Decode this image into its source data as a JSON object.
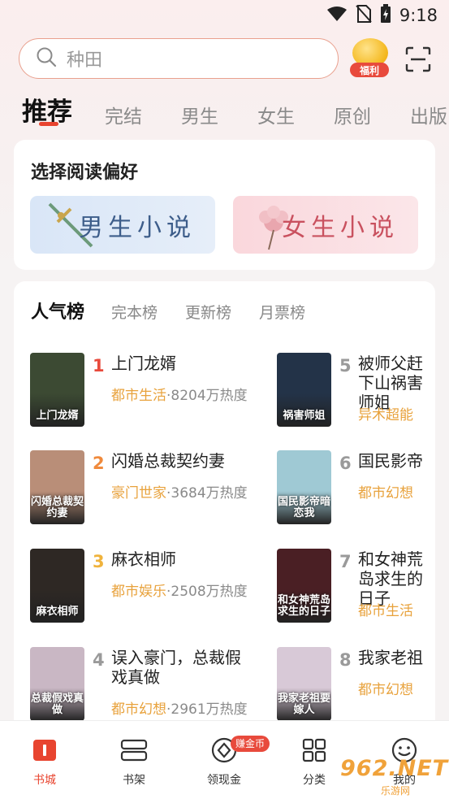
{
  "status_bar": {
    "time": "9:18"
  },
  "search": {
    "placeholder": "种田"
  },
  "welfare": {
    "label": "福利"
  },
  "tabs": [
    {
      "label": "推荐",
      "active": true
    },
    {
      "label": "完结"
    },
    {
      "label": "男生"
    },
    {
      "label": "女生"
    },
    {
      "label": "原创"
    },
    {
      "label": "出版"
    }
  ],
  "preference": {
    "title": "选择阅读偏好",
    "male_label": "男生小说",
    "female_label": "女生小说"
  },
  "rankings": {
    "tabs": [
      "人气榜",
      "完本榜",
      "更新榜",
      "月票榜"
    ],
    "books": [
      {
        "rank": "1",
        "title": "上门龙婿",
        "genre": "都市生活",
        "heat": "8204万热度",
        "cover_text": "上门龙婿",
        "cover_color": "#3c4a33",
        "rank_color": "#e84a3c"
      },
      {
        "rank": "2",
        "title": "闪婚总裁契约妻",
        "genre": "豪门世家",
        "heat": "3684万热度",
        "cover_text": "闪婚总裁契约妻",
        "cover_color": "#b98e78",
        "rank_color": "#f08a3c"
      },
      {
        "rank": "3",
        "title": "麻衣相师",
        "genre": "都市娱乐",
        "heat": "2508万热度",
        "cover_text": "麻衣相师",
        "cover_color": "#2e2824",
        "rank_color": "#f0b33c"
      },
      {
        "rank": "4",
        "title": "误入豪门，总裁假戏真做",
        "genre": "都市幻想",
        "heat": "2961万热度",
        "cover_text": "总裁假戏真做",
        "cover_color": "#c9b7c4",
        "rank_color": "#9a9a9a"
      },
      {
        "rank": "5",
        "title": "被师父赶下山祸害师姐",
        "genre": "异术超能",
        "heat": "",
        "cover_text": "祸害师姐",
        "cover_color": "#233348",
        "rank_color": "#9a9a9a"
      },
      {
        "rank": "6",
        "title": "国民影帝暗恋我",
        "genre": "都市幻想",
        "heat": "",
        "cover_text": "国民影帝暗恋我",
        "cover_color": "#9fc9d4",
        "rank_color": "#9a9a9a"
      },
      {
        "rank": "7",
        "title": "和女神荒岛求生的日子",
        "genre": "都市生活",
        "heat": "",
        "cover_text": "和女神荒岛求生的日子",
        "cover_color": "#4a1f24",
        "rank_color": "#9a9a9a"
      },
      {
        "rank": "8",
        "title": "我家老祖要嫁人",
        "genre": "都市幻想",
        "heat": "",
        "cover_text": "我家老祖要嫁人",
        "cover_color": "#d8c9d7",
        "rank_color": "#9a9a9a"
      }
    ]
  },
  "bottom_nav": [
    {
      "label": "书城",
      "active": true
    },
    {
      "label": "书架"
    },
    {
      "label": "领现金"
    },
    {
      "label": "分类"
    },
    {
      "label": "我的"
    }
  ],
  "earn_badge": "赚金币",
  "watermark": {
    "main": "962.NET",
    "sub": "乐游网"
  },
  "colors": {
    "accent": "#e8442f",
    "genre": "#e8a23c"
  }
}
